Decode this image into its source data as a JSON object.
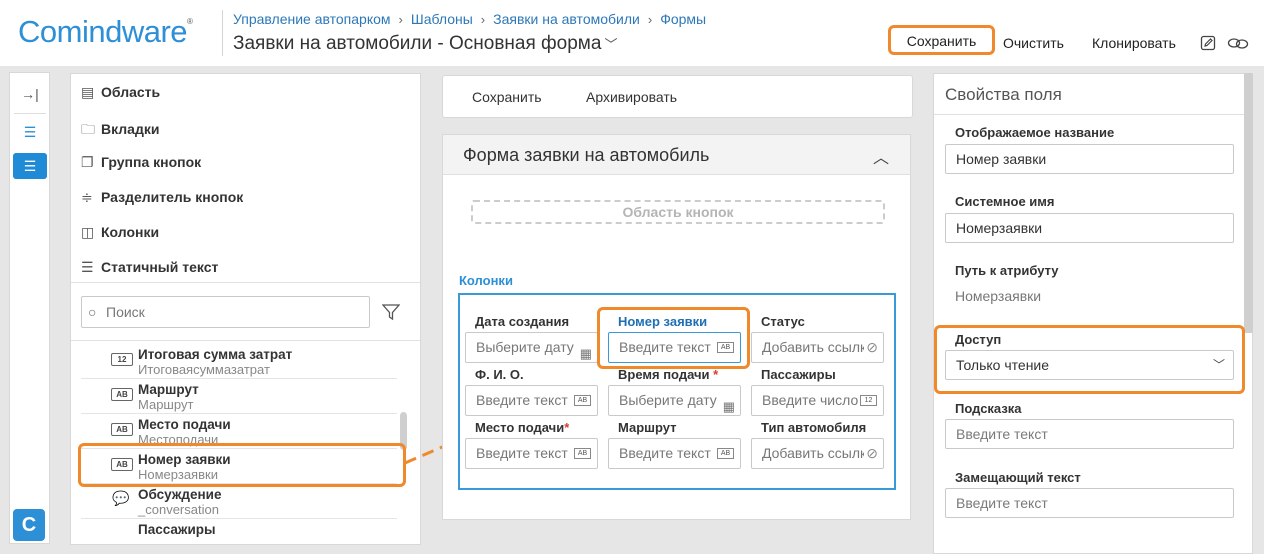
{
  "header": {
    "logo": "Comindware",
    "breadcrumbs": [
      "Управление автопарком",
      "Шаблоны",
      "Заявки на автомобили",
      "Формы"
    ],
    "title": "Заявки на автомобили - Основная форма",
    "buttons": {
      "save": "Сохранить",
      "clear": "Очистить",
      "clone": "Клонировать"
    }
  },
  "components": [
    "Область",
    "Вкладки",
    "Группа кнопок",
    "Разделитель кнопок",
    "Колонки",
    "Статичный текст"
  ],
  "search": {
    "placeholder": "Поиск"
  },
  "fields": [
    {
      "name": "Итоговая сумма затрат",
      "sys": "Итоговаясуммазатрат",
      "icon": "12"
    },
    {
      "name": "Маршрут",
      "sys": "Маршрут",
      "icon": "AB"
    },
    {
      "name": "Место подачи",
      "sys": "Местоподачи",
      "icon": "AB"
    },
    {
      "name": "Номер заявки",
      "sys": "Номерзаявки",
      "icon": "AB"
    },
    {
      "name": "Обсуждение",
      "sys": "_conversation",
      "icon": "chat"
    },
    {
      "name": "Пассажиры",
      "sys": "",
      "icon": ""
    }
  ],
  "actions": {
    "save": "Сохранить",
    "archive": "Архивировать"
  },
  "form": {
    "title": "Форма заявки на автомобиль",
    "buttons_area": "Область кнопок",
    "columns_label": "Колонки",
    "rows": [
      [
        {
          "label": "Дата создания",
          "ph": "Выберите дату"
        },
        {
          "label": "Номер заявки",
          "ph": "Введите текст"
        },
        {
          "label": "Статус",
          "ph": "Добавить ссылку"
        }
      ],
      [
        {
          "label": "Ф. И. О.",
          "ph": "Введите текст"
        },
        {
          "label": "Время подачи",
          "ph": "Выберите дату"
        },
        {
          "label": "Пассажиры",
          "ph": "Введите число"
        }
      ],
      [
        {
          "label": "Место подачи",
          "ph": "Введите текст"
        },
        {
          "label": "Маршрут",
          "ph": "Введите текст"
        },
        {
          "label": "Тип автомобиля",
          "ph": "Добавить ссылку"
        }
      ]
    ],
    "required_mark": "*"
  },
  "properties": {
    "title": "Свойства поля",
    "display_name_label": "Отображаемое название",
    "display_name_value": "Номер заявки",
    "system_name_label": "Системное имя",
    "system_name_value": "Номерзаявки",
    "path_label": "Путь к атрибуту",
    "path_value": "Номерзаявки",
    "access_label": "Доступ",
    "access_value": "Только чтение",
    "hint_label": "Подсказка",
    "hint_placeholder": "Введите текст",
    "placeholder_label": "Замещающий текст",
    "placeholder_placeholder": "Введите текст"
  },
  "colors": {
    "accent": "#2d8fd6",
    "highlight": "#f0882c"
  }
}
